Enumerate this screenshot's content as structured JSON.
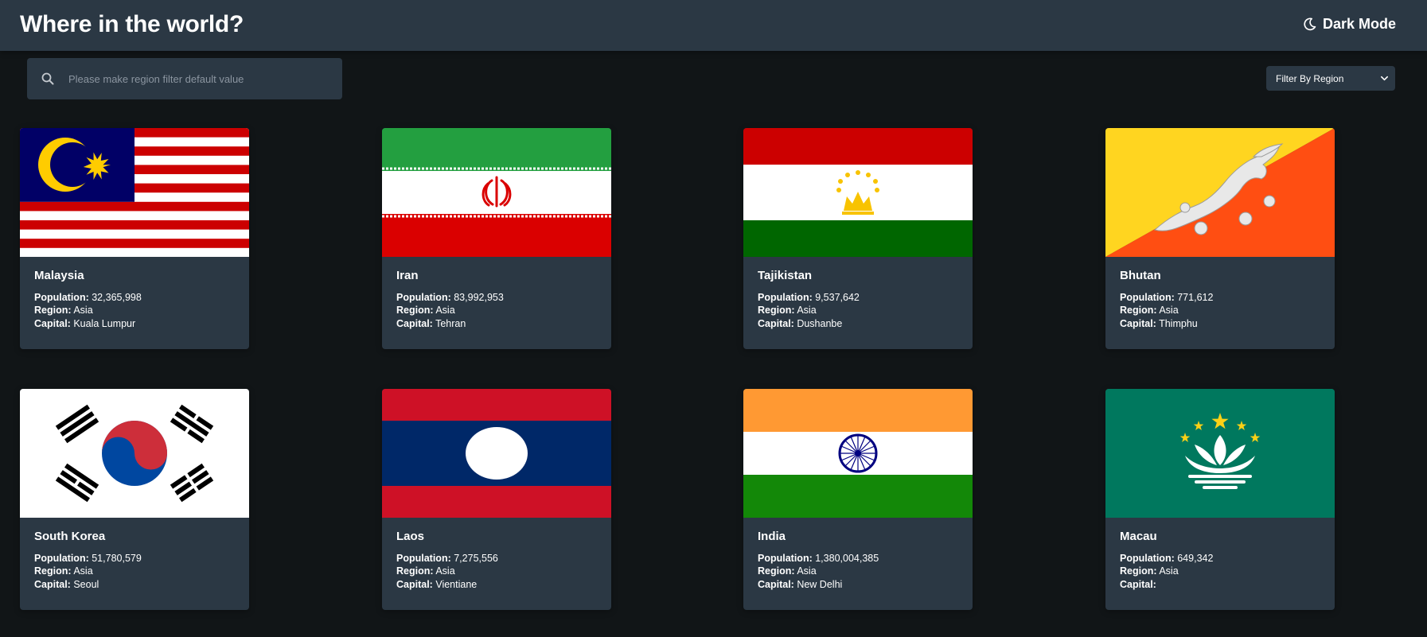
{
  "header": {
    "title": "Where in the world?",
    "theme_toggle_label": "Dark Mode"
  },
  "search": {
    "placeholder": "Please make region filter default value",
    "value": ""
  },
  "filter": {
    "label": "Filter By Region"
  },
  "labels": {
    "population": "Population:",
    "region": "Region:",
    "capital": "Capital:"
  },
  "colors": {
    "background": "#111517",
    "element": "#2b3844",
    "text": "#ffffff"
  },
  "countries": [
    {
      "name": "Malaysia",
      "population": "32,365,998",
      "region": "Asia",
      "capital": "Kuala Lumpur",
      "flag": "malaysia-flag"
    },
    {
      "name": "Iran",
      "population": "83,992,953",
      "region": "Asia",
      "capital": "Tehran",
      "flag": "iran-flag"
    },
    {
      "name": "Tajikistan",
      "population": "9,537,642",
      "region": "Asia",
      "capital": "Dushanbe",
      "flag": "tajikistan-flag"
    },
    {
      "name": "Bhutan",
      "population": "771,612",
      "region": "Asia",
      "capital": "Thimphu",
      "flag": "bhutan-flag"
    },
    {
      "name": "South Korea",
      "population": "51,780,579",
      "region": "Asia",
      "capital": "Seoul",
      "flag": "south-korea-flag"
    },
    {
      "name": "Laos",
      "population": "7,275,556",
      "region": "Asia",
      "capital": "Vientiane",
      "flag": "laos-flag"
    },
    {
      "name": "India",
      "population": "1,380,004,385",
      "region": "Asia",
      "capital": "New Delhi",
      "flag": "india-flag"
    },
    {
      "name": "Macau",
      "population": "649,342",
      "region": "Asia",
      "capital": "",
      "flag": "macau-flag"
    }
  ]
}
